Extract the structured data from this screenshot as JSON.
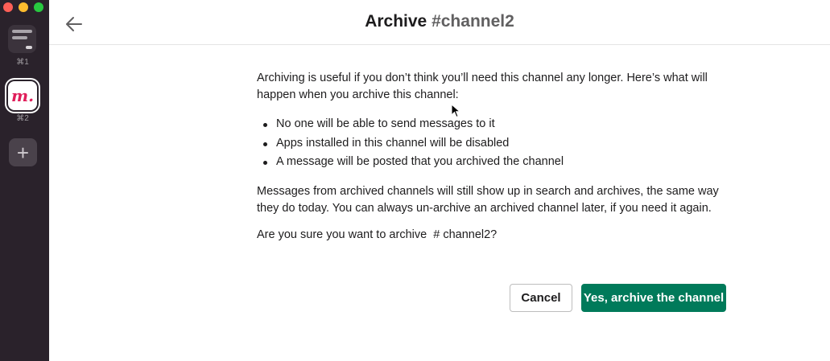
{
  "rail": {
    "workspaces": [
      {
        "shortcut": "⌘1"
      },
      {
        "logo_text": "m.",
        "shortcut": "⌘2"
      }
    ],
    "add_label": "+"
  },
  "header": {
    "title_prefix": "Archive",
    "title_channel": "#channel2"
  },
  "body": {
    "intro": "Archiving is useful if you don’t think you’ll need this channel any longer. Here’s what will happen when you archive this channel:",
    "bullets": [
      "No one will be able to send messages to it",
      "Apps installed in this channel will be disabled",
      "A message will be posted that you archived the channel"
    ],
    "note": "Messages from archived channels will still show up in search and archives, the same way they do today. You can always un-archive an archived channel later, if you need it again.",
    "question_prefix": "Are you sure you want to archive",
    "question_channel": "# channel2?"
  },
  "buttons": {
    "cancel": "Cancel",
    "confirm": "Yes, archive the channel"
  },
  "colors": {
    "rail_bg": "#2a222b",
    "confirm_bg": "#007a5a",
    "logo": "#e01e5a"
  }
}
